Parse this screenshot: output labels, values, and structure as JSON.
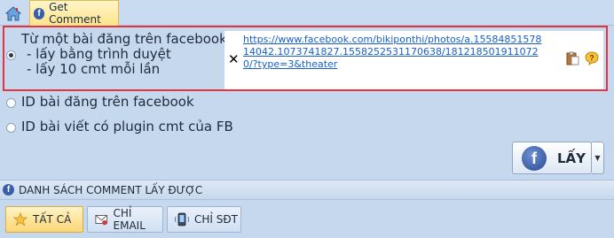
{
  "tabs": {
    "home_icon": "home-icon",
    "active_label": "Get Comment"
  },
  "source_options": [
    {
      "label_lines": [
        "Từ một bài đăng trên facebook",
        "  - lấy bằng trình duyệt",
        "  - lấy 10 cmt mỗi lần"
      ],
      "selected": true
    },
    {
      "label": "ID bài đăng trên facebook",
      "selected": false
    },
    {
      "label": "ID bài viết có plugin cmt của FB",
      "selected": false
    }
  ],
  "url_input": {
    "value": "https://www.facebook.com/bikiponthi/photos/a.1558485157814042.1073741827.1558252531170638/1812185019110720/?type=3&theater",
    "clear_symbol": "✕"
  },
  "get_button": {
    "label": "LẤY",
    "icon": "facebook-icon"
  },
  "section": {
    "title": "DANH SÁCH COMMENT LẤY ĐƯỢC"
  },
  "filters": [
    {
      "label": "TẤT CẢ",
      "icon": "star-icon",
      "active": true
    },
    {
      "label": "CHỈ EMAIL",
      "icon": "email-icon",
      "active": false
    },
    {
      "label": "CHỈ SĐT",
      "icon": "phone-icon",
      "active": false
    }
  ],
  "colors": {
    "background": "#c6d8ee",
    "highlight_border": "#e3343f",
    "link": "#1a5fc8",
    "active_tab": "#fde38a"
  }
}
